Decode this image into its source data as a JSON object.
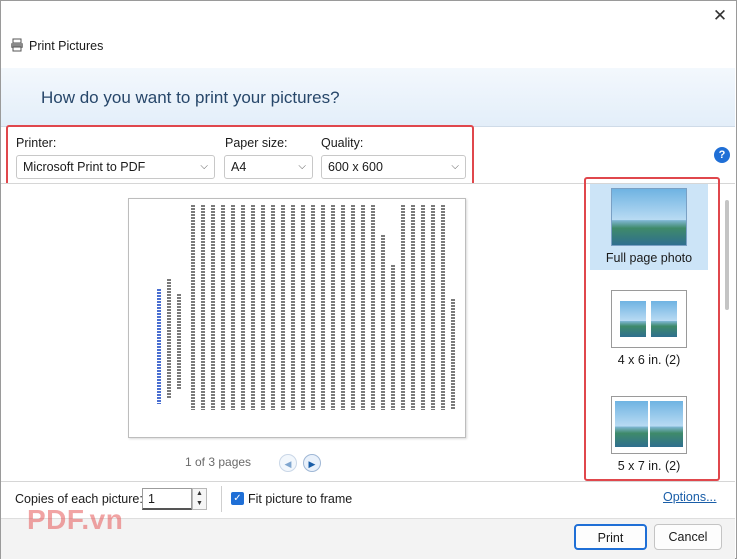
{
  "window": {
    "title": "Print Pictures",
    "close_glyph": "✕"
  },
  "banner": {
    "question": "How do you want to print your pictures?"
  },
  "settings": {
    "printer": {
      "label": "Printer:",
      "value": "Microsoft Print to PDF"
    },
    "paper_size": {
      "label": "Paper size:",
      "value": "A4"
    },
    "quality": {
      "label": "Quality:",
      "value": "600 x 600"
    },
    "help_glyph": "?"
  },
  "preview": {
    "page_count": "1 of 3 pages",
    "prev_glyph": "◀",
    "next_glyph": "▶"
  },
  "layouts": [
    {
      "label": "Full page photo",
      "selected": true
    },
    {
      "label": "4 x 6 in. (2)",
      "selected": false
    },
    {
      "label": "5 x 7 in. (2)",
      "selected": false
    }
  ],
  "bottom": {
    "copies_label": "Copies of each picture:",
    "copies_value": "1",
    "fit_label": "Fit picture to frame",
    "fit_checked": true,
    "options_link": "Options..."
  },
  "footer": {
    "watermark": "PDF.vn",
    "print_label": "Print",
    "cancel_label": "Cancel"
  },
  "colors": {
    "accent": "#1f6fd6",
    "highlight_box": "#e0474c",
    "selected_bg": "#cce4f7"
  }
}
